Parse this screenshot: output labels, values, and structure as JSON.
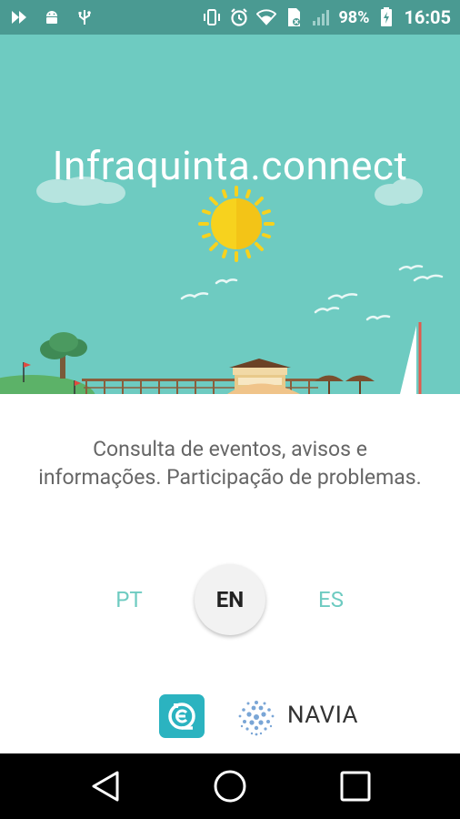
{
  "status_bar": {
    "battery_percent": "98%",
    "time": "16:05",
    "icons": [
      "notification-icon",
      "android-icon",
      "usb-icon",
      "vibrate-icon",
      "alarm-icon",
      "wifi-icon",
      "no-sim-icon",
      "signal-icon",
      "battery-icon"
    ]
  },
  "hero": {
    "title": "Infraquinta.connect"
  },
  "description": "Consulta de eventos, avisos e informações. Participação de problemas.",
  "languages": {
    "pt": "PT",
    "en": "EN",
    "es": "ES",
    "selected": "EN"
  },
  "partners": {
    "navia_label": "NAVIA"
  },
  "colors": {
    "accent": "#6ecbc1",
    "status_bar": "#4a9a92",
    "sun": "#f7d21e",
    "partner_icon": "#2bb3c0"
  }
}
